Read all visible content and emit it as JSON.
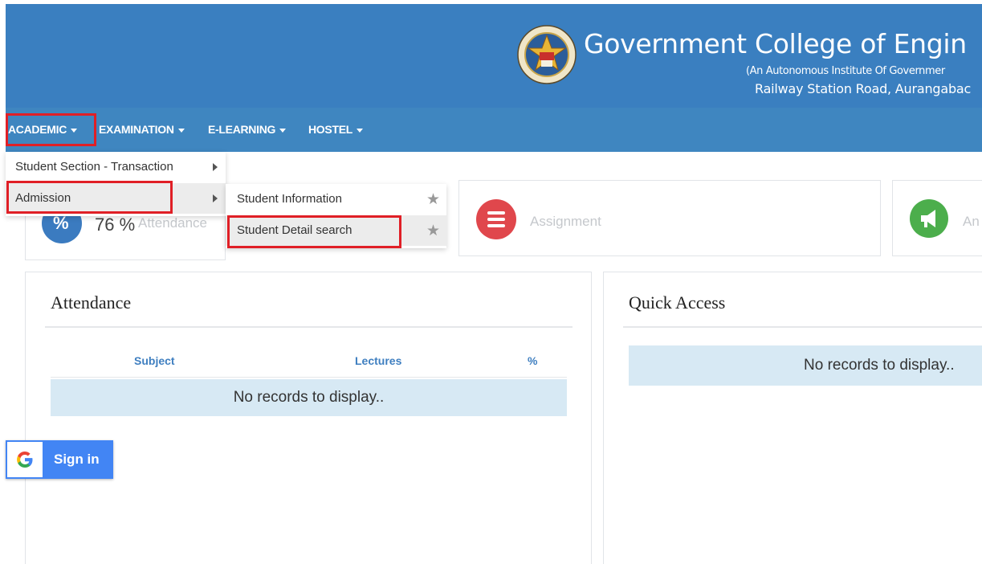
{
  "header": {
    "title": "Government College of Engin",
    "subtitle": "(An Autonomous Institute Of Governmer",
    "address": "Railway Station Road, Aurangabac"
  },
  "nav": {
    "items": [
      {
        "label": "ACADEMIC"
      },
      {
        "label": "EXAMINATION"
      },
      {
        "label": "E-LEARNING"
      },
      {
        "label": "HOSTEL"
      }
    ]
  },
  "menu": {
    "level1": [
      {
        "label": "Student Section - Transaction"
      },
      {
        "label": "Admission"
      }
    ],
    "level2": [
      {
        "label": "Student Information"
      },
      {
        "label": "Student Detail search"
      }
    ]
  },
  "stats": {
    "attendance_value": "76 %",
    "attendance_label": "Attendance",
    "assignment_label": "Assignment",
    "announcement_label": "An"
  },
  "attendance_panel": {
    "title": "Attendance",
    "columns": [
      "Subject",
      "Lectures",
      "%"
    ],
    "empty_message": "No records to display.."
  },
  "quick_access": {
    "title": "Quick Access",
    "empty_message": "No records to display.."
  },
  "signin": {
    "label": "Sign in"
  },
  "colors": {
    "header_bg": "#3a7fc0",
    "nav_bg": "#3f86c0",
    "highlight_red": "#e01f26",
    "assignment_icon": "#e0474c",
    "announcement_icon": "#4cae4c",
    "attendance_icon": "#3b7bc0",
    "google_blue": "#4285f4"
  }
}
